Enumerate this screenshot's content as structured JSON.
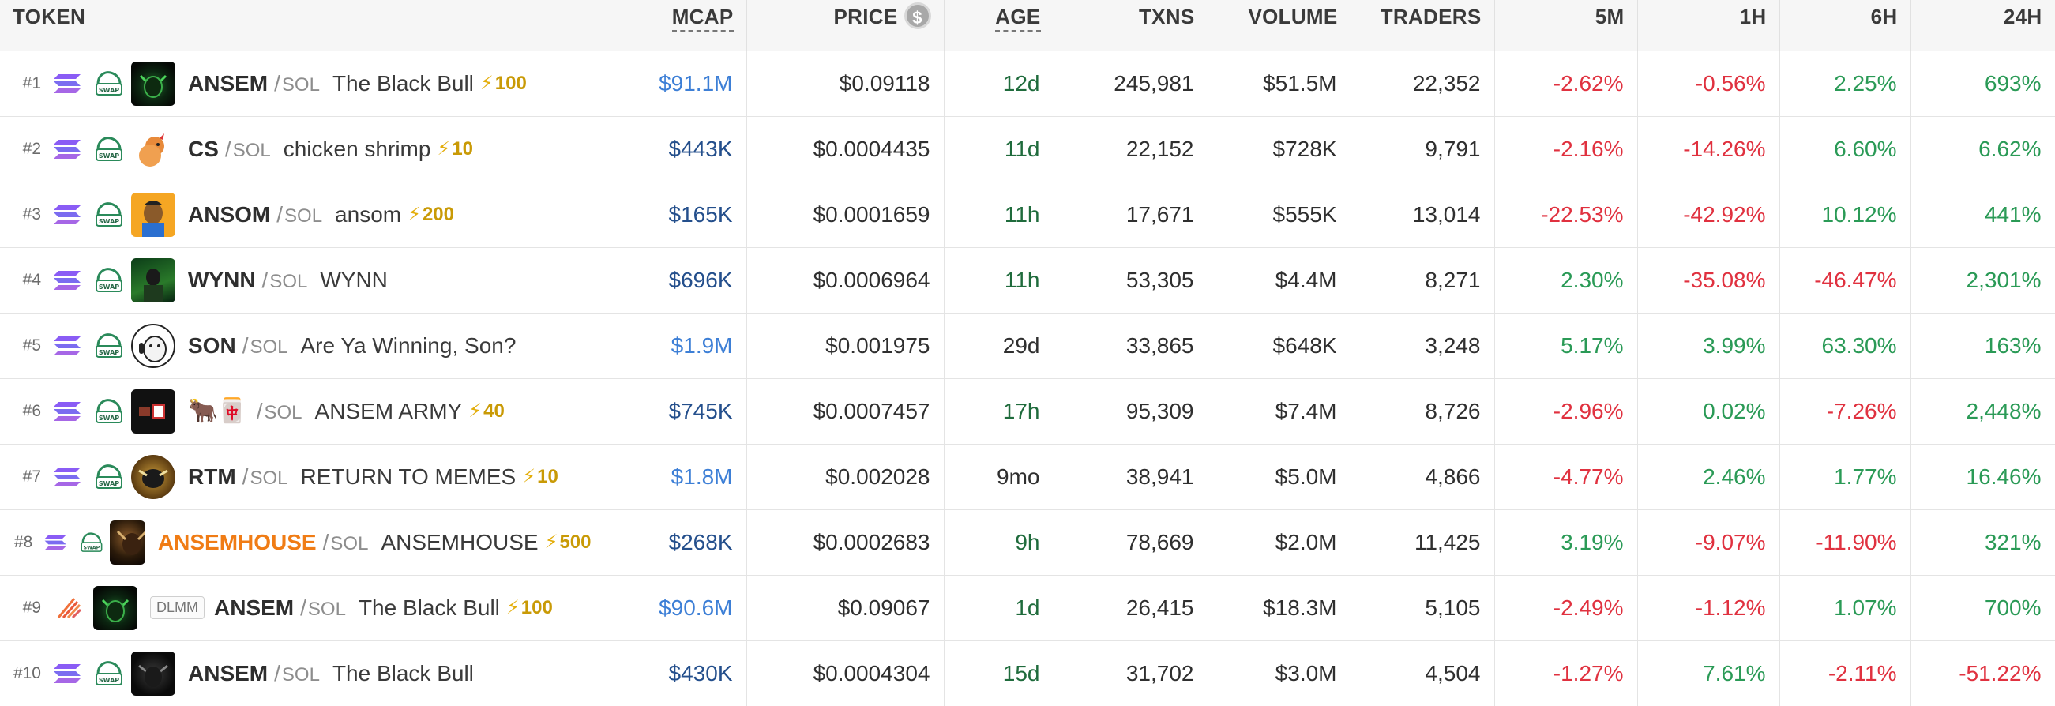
{
  "headers": {
    "token": "TOKEN",
    "mcap": "MCAP",
    "price": "PRICE",
    "price_icon": "$",
    "age": "AGE",
    "txns": "TXNS",
    "volume": "VOLUME",
    "traders": "TRADERS",
    "m5": "5M",
    "h1": "1H",
    "h6": "6H",
    "h24": "24H"
  },
  "colors": {
    "positive": "#2a9a56",
    "negative": "#e0313f",
    "mcap_blue": "#3d7fd6",
    "boost_gold": "#c99a06",
    "highlight_orange": "#f07c15"
  },
  "rows": [
    {
      "rank": "#1",
      "dex": "swap",
      "symbol": "ANSEM",
      "pair": "SOL",
      "name": "The Black Bull",
      "boost": "100",
      "mcap": "$91.1M",
      "price": "$0.09118",
      "age": "12d",
      "txns": "245,981",
      "volume": "$51.5M",
      "traders": "22,352",
      "m5": "-2.62%",
      "h1": "-0.56%",
      "h6": "2.25%",
      "h24": "693%"
    },
    {
      "rank": "#2",
      "dex": "swap",
      "symbol": "CS",
      "pair": "SOL",
      "name": "chicken shrimp",
      "boost": "10",
      "mcap": "$443K",
      "price": "$0.0004435",
      "age": "11d",
      "txns": "22,152",
      "volume": "$728K",
      "traders": "9,791",
      "m5": "-2.16%",
      "h1": "-14.26%",
      "h6": "6.60%",
      "h24": "6.62%"
    },
    {
      "rank": "#3",
      "dex": "swap",
      "symbol": "ANSOM",
      "pair": "SOL",
      "name": "ansom",
      "boost": "200",
      "mcap": "$165K",
      "price": "$0.0001659",
      "age": "11h",
      "txns": "17,671",
      "volume": "$555K",
      "traders": "13,014",
      "m5": "-22.53%",
      "h1": "-42.92%",
      "h6": "10.12%",
      "h24": "441%"
    },
    {
      "rank": "#4",
      "dex": "swap",
      "symbol": "WYNN",
      "pair": "SOL",
      "name": "WYNN",
      "boost": "",
      "mcap": "$696K",
      "price": "$0.0006964",
      "age": "11h",
      "txns": "53,305",
      "volume": "$4.4M",
      "traders": "8,271",
      "m5": "2.30%",
      "h1": "-35.08%",
      "h6": "-46.47%",
      "h24": "2,301%"
    },
    {
      "rank": "#5",
      "dex": "swap",
      "symbol": "SON",
      "pair": "SOL",
      "name": "Are Ya Winning, Son?",
      "boost": "",
      "mcap": "$1.9M",
      "price": "$0.001975",
      "age": "29d",
      "txns": "33,865",
      "volume": "$648K",
      "traders": "3,248",
      "m5": "5.17%",
      "h1": "3.99%",
      "h6": "63.30%",
      "h24": "163%"
    },
    {
      "rank": "#6",
      "dex": "swap",
      "symbol": "🐂🀄",
      "pair": "SOL",
      "name": "ANSEM ARMY",
      "boost": "40",
      "mcap": "$745K",
      "price": "$0.0007457",
      "age": "17h",
      "txns": "95,309",
      "volume": "$7.4M",
      "traders": "8,726",
      "m5": "-2.96%",
      "h1": "0.02%",
      "h6": "-7.26%",
      "h24": "2,448%"
    },
    {
      "rank": "#7",
      "dex": "swap",
      "symbol": "RTM",
      "pair": "SOL",
      "name": "RETURN TO MEMES",
      "boost": "10",
      "mcap": "$1.8M",
      "price": "$0.002028",
      "age": "9mo",
      "txns": "38,941",
      "volume": "$5.0M",
      "traders": "4,866",
      "m5": "-4.77%",
      "h1": "2.46%",
      "h6": "1.77%",
      "h24": "16.46%"
    },
    {
      "rank": "#8",
      "dex": "swap",
      "symbol": "ANSEMHOUSE",
      "pair": "SOL",
      "name": "ANSEMHOUSE",
      "boost": "500",
      "mcap": "$268K",
      "price": "$0.0002683",
      "age": "9h",
      "txns": "78,669",
      "volume": "$2.0M",
      "traders": "11,425",
      "m5": "3.19%",
      "h1": "-9.07%",
      "h6": "-11.90%",
      "h24": "321%"
    },
    {
      "rank": "#9",
      "dex": "meteora",
      "dlmm": "DLMM",
      "symbol": "ANSEM",
      "pair": "SOL",
      "name": "The Black Bull",
      "boost": "100",
      "mcap": "$90.6M",
      "price": "$0.09067",
      "age": "1d",
      "txns": "26,415",
      "volume": "$18.3M",
      "traders": "5,105",
      "m5": "-2.49%",
      "h1": "-1.12%",
      "h6": "1.07%",
      "h24": "700%"
    },
    {
      "rank": "#10",
      "dex": "swap",
      "symbol": "ANSEM",
      "pair": "SOL",
      "name": "The Black Bull",
      "boost": "",
      "mcap": "$430K",
      "price": "$0.0004304",
      "age": "15d",
      "txns": "31,702",
      "volume": "$3.0M",
      "traders": "4,504",
      "m5": "-1.27%",
      "h1": "7.61%",
      "h6": "-2.11%",
      "h24": "-51.22%"
    }
  ]
}
